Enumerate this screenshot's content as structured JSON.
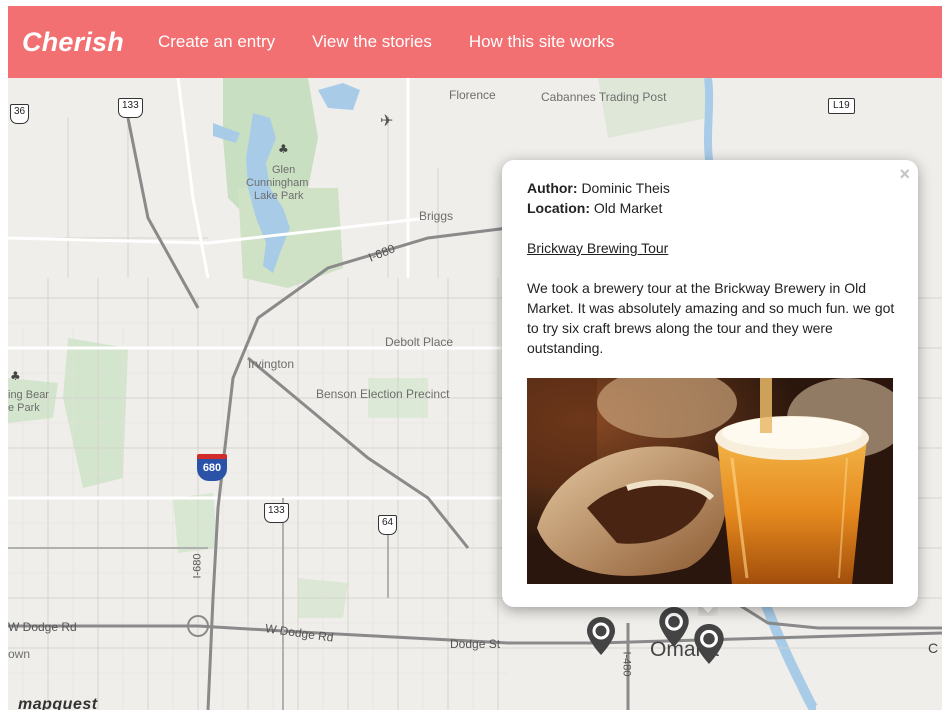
{
  "nav": {
    "brand": "Cherish",
    "links": [
      "Create an entry",
      "View the stories",
      "How this site works"
    ]
  },
  "map": {
    "labels": {
      "florence": "Florence",
      "cabannes": "Cabannes Trading Post",
      "glen": "Glen",
      "cunningham": "Cunningham",
      "lake_park": "Lake Park",
      "briggs": "Briggs",
      "i680": "I-680",
      "debolt": "Debolt Place",
      "irvington": "Irvington",
      "benson": "Benson Election Precinct",
      "bear1": "ing Bear",
      "bear2": "e Park",
      "i680_vertical": "I-680",
      "w_dodge_rd_left": "W Dodge Rd",
      "w_dodge_rd": "W Dodge Rd",
      "dodge_st": "Dodge St",
      "own": "own",
      "omaha": "Omaha",
      "i480": "I-480",
      "c": "C"
    },
    "shields": {
      "s36": "36",
      "s133_top": "133",
      "l19": "L19",
      "s133": "133",
      "s64": "64",
      "i680_shield": "680"
    },
    "attribution": "mapquest"
  },
  "popup": {
    "close": "×",
    "author_label": "Author:",
    "author": "Dominic Theis",
    "location_label": "Location:",
    "location": "Old Market",
    "title": "Brickway Brewing Tour",
    "text": "We took a brewery tour at the Brickway Brewery in Old Market. It was absolutely amazing and so much fun. we got to try six craft brews along the tour and they were outstanding."
  },
  "colors": {
    "navbar": "#f26f72",
    "water": "#a8cce8",
    "park": "#c9dfc1",
    "road": "#ffffff",
    "pin": "#444444"
  }
}
